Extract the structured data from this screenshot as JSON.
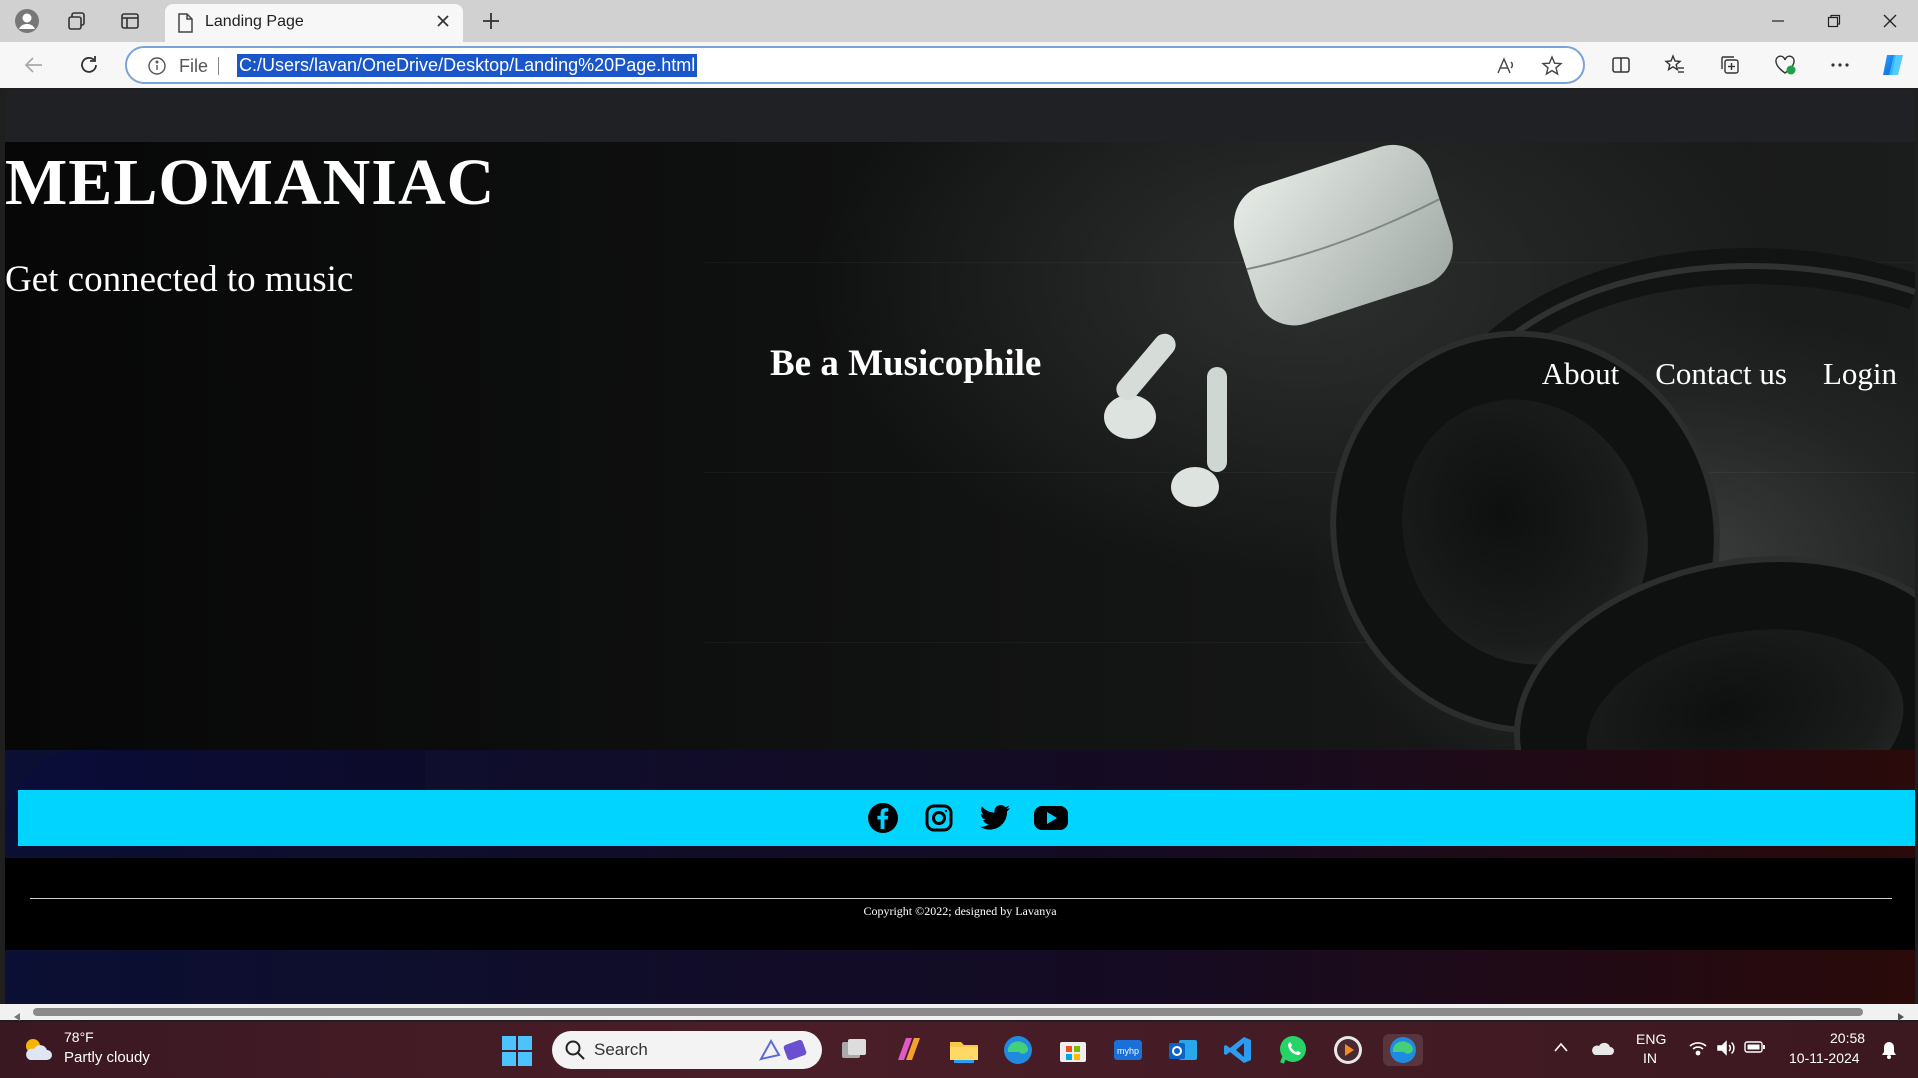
{
  "browser": {
    "tab_title": "Landing Page",
    "address_label": "File",
    "url": "C:/Users/lavan/OneDrive/Desktop/Landing%20Page.html"
  },
  "page": {
    "site_title": "MELOMANIAC",
    "tagline": "Get connected to music",
    "hero_heading": "Be a Musicophile",
    "nav": [
      "About",
      "Contact us",
      "Login"
    ],
    "social_icons": [
      "facebook-icon",
      "instagram-icon",
      "twitter-icon",
      "youtube-icon"
    ],
    "copyright": "Copyright ©2022; designed by Lavanya",
    "social_bar_color": "#00d4ff"
  },
  "taskbar": {
    "weather_temp": "78°F",
    "weather_desc": "Partly cloudy",
    "search_placeholder": "Search",
    "lang_line1": "ENG",
    "lang_line2": "IN",
    "time": "20:58",
    "date": "10-11-2024"
  }
}
